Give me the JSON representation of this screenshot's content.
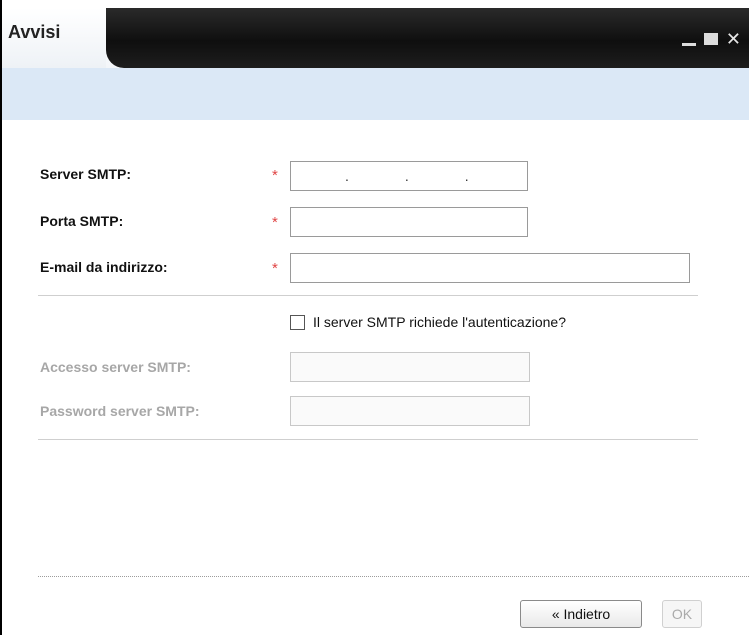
{
  "window": {
    "title": "Avvisi",
    "controls": {
      "minimize": "_",
      "maximize": "▆",
      "close": "✕"
    }
  },
  "form": {
    "smtp_server": {
      "label": "Server SMTP:",
      "required_mark": "*",
      "value_dots": [
        ".",
        ".",
        "."
      ]
    },
    "smtp_port": {
      "label": "Porta SMTP:",
      "required_mark": "*",
      "value": ""
    },
    "from_email": {
      "label": "E-mail da indirizzo:",
      "required_mark": "*",
      "value": ""
    },
    "auth_checkbox": {
      "label": "Il server SMTP richiede l'autenticazione?",
      "checked": false
    },
    "smtp_login": {
      "label": "Accesso server SMTP:",
      "value": "",
      "disabled": true
    },
    "smtp_password": {
      "label": "Password server SMTP:",
      "value": "",
      "disabled": true
    }
  },
  "buttons": {
    "back_label": "« Indietro",
    "ok_label": "OK"
  },
  "colors": {
    "required": "#e04545",
    "header_band": "#dbe8f6",
    "title_bar": "#111111"
  }
}
